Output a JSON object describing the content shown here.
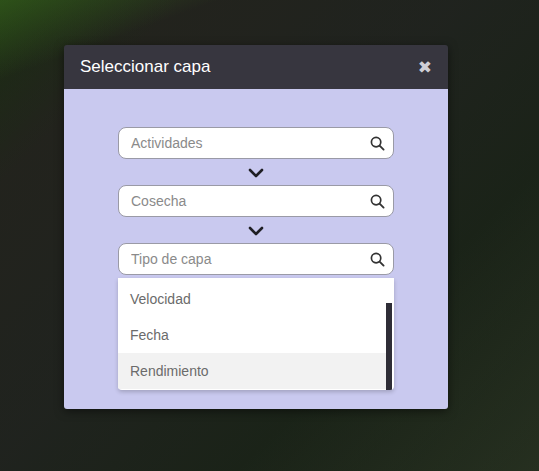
{
  "window": {
    "title": "Seleccionar capa",
    "close": "✖"
  },
  "fields": [
    {
      "placeholder": "Actividades",
      "focused": false
    },
    {
      "placeholder": "Cosecha",
      "focused": false
    },
    {
      "placeholder": "Tipo de capa",
      "focused": true
    }
  ],
  "dropdown": {
    "options": [
      {
        "label": "Velocidad",
        "highlighted": false
      },
      {
        "label": "Fecha",
        "highlighted": false
      },
      {
        "label": "Rendimiento",
        "highlighted": true
      }
    ],
    "scrollbar": {
      "offset": 0.22,
      "level": 0.78
    }
  }
}
